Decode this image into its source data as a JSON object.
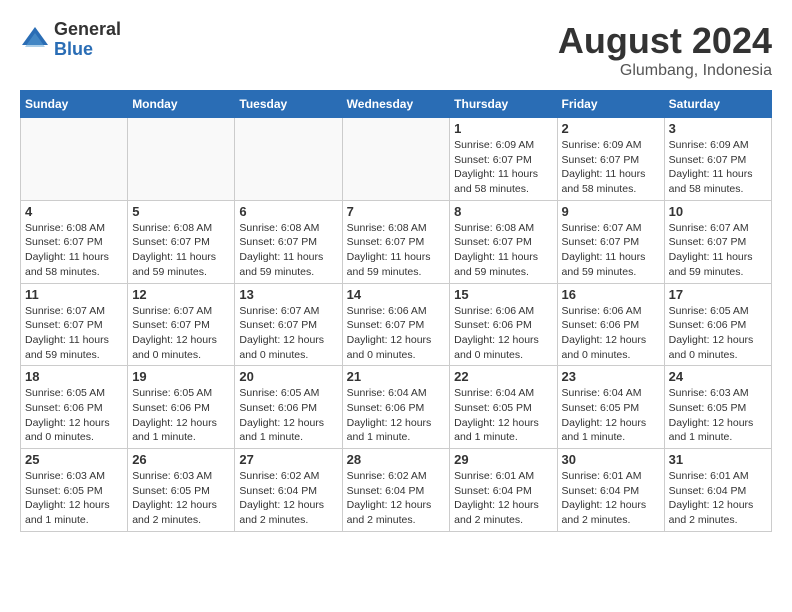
{
  "header": {
    "logo_general": "General",
    "logo_blue": "Blue",
    "month_year": "August 2024",
    "location": "Glumbang, Indonesia"
  },
  "days_of_week": [
    "Sunday",
    "Monday",
    "Tuesday",
    "Wednesday",
    "Thursday",
    "Friday",
    "Saturday"
  ],
  "weeks": [
    [
      {
        "day": "",
        "info": ""
      },
      {
        "day": "",
        "info": ""
      },
      {
        "day": "",
        "info": ""
      },
      {
        "day": "",
        "info": ""
      },
      {
        "day": "1",
        "info": "Sunrise: 6:09 AM\nSunset: 6:07 PM\nDaylight: 11 hours\nand 58 minutes."
      },
      {
        "day": "2",
        "info": "Sunrise: 6:09 AM\nSunset: 6:07 PM\nDaylight: 11 hours\nand 58 minutes."
      },
      {
        "day": "3",
        "info": "Sunrise: 6:09 AM\nSunset: 6:07 PM\nDaylight: 11 hours\nand 58 minutes."
      }
    ],
    [
      {
        "day": "4",
        "info": "Sunrise: 6:08 AM\nSunset: 6:07 PM\nDaylight: 11 hours\nand 58 minutes."
      },
      {
        "day": "5",
        "info": "Sunrise: 6:08 AM\nSunset: 6:07 PM\nDaylight: 11 hours\nand 59 minutes."
      },
      {
        "day": "6",
        "info": "Sunrise: 6:08 AM\nSunset: 6:07 PM\nDaylight: 11 hours\nand 59 minutes."
      },
      {
        "day": "7",
        "info": "Sunrise: 6:08 AM\nSunset: 6:07 PM\nDaylight: 11 hours\nand 59 minutes."
      },
      {
        "day": "8",
        "info": "Sunrise: 6:08 AM\nSunset: 6:07 PM\nDaylight: 11 hours\nand 59 minutes."
      },
      {
        "day": "9",
        "info": "Sunrise: 6:07 AM\nSunset: 6:07 PM\nDaylight: 11 hours\nand 59 minutes."
      },
      {
        "day": "10",
        "info": "Sunrise: 6:07 AM\nSunset: 6:07 PM\nDaylight: 11 hours\nand 59 minutes."
      }
    ],
    [
      {
        "day": "11",
        "info": "Sunrise: 6:07 AM\nSunset: 6:07 PM\nDaylight: 11 hours\nand 59 minutes."
      },
      {
        "day": "12",
        "info": "Sunrise: 6:07 AM\nSunset: 6:07 PM\nDaylight: 12 hours\nand 0 minutes."
      },
      {
        "day": "13",
        "info": "Sunrise: 6:07 AM\nSunset: 6:07 PM\nDaylight: 12 hours\nand 0 minutes."
      },
      {
        "day": "14",
        "info": "Sunrise: 6:06 AM\nSunset: 6:07 PM\nDaylight: 12 hours\nand 0 minutes."
      },
      {
        "day": "15",
        "info": "Sunrise: 6:06 AM\nSunset: 6:06 PM\nDaylight: 12 hours\nand 0 minutes."
      },
      {
        "day": "16",
        "info": "Sunrise: 6:06 AM\nSunset: 6:06 PM\nDaylight: 12 hours\nand 0 minutes."
      },
      {
        "day": "17",
        "info": "Sunrise: 6:05 AM\nSunset: 6:06 PM\nDaylight: 12 hours\nand 0 minutes."
      }
    ],
    [
      {
        "day": "18",
        "info": "Sunrise: 6:05 AM\nSunset: 6:06 PM\nDaylight: 12 hours\nand 0 minutes."
      },
      {
        "day": "19",
        "info": "Sunrise: 6:05 AM\nSunset: 6:06 PM\nDaylight: 12 hours\nand 1 minute."
      },
      {
        "day": "20",
        "info": "Sunrise: 6:05 AM\nSunset: 6:06 PM\nDaylight: 12 hours\nand 1 minute."
      },
      {
        "day": "21",
        "info": "Sunrise: 6:04 AM\nSunset: 6:06 PM\nDaylight: 12 hours\nand 1 minute."
      },
      {
        "day": "22",
        "info": "Sunrise: 6:04 AM\nSunset: 6:05 PM\nDaylight: 12 hours\nand 1 minute."
      },
      {
        "day": "23",
        "info": "Sunrise: 6:04 AM\nSunset: 6:05 PM\nDaylight: 12 hours\nand 1 minute."
      },
      {
        "day": "24",
        "info": "Sunrise: 6:03 AM\nSunset: 6:05 PM\nDaylight: 12 hours\nand 1 minute."
      }
    ],
    [
      {
        "day": "25",
        "info": "Sunrise: 6:03 AM\nSunset: 6:05 PM\nDaylight: 12 hours\nand 1 minute."
      },
      {
        "day": "26",
        "info": "Sunrise: 6:03 AM\nSunset: 6:05 PM\nDaylight: 12 hours\nand 2 minutes."
      },
      {
        "day": "27",
        "info": "Sunrise: 6:02 AM\nSunset: 6:04 PM\nDaylight: 12 hours\nand 2 minutes."
      },
      {
        "day": "28",
        "info": "Sunrise: 6:02 AM\nSunset: 6:04 PM\nDaylight: 12 hours\nand 2 minutes."
      },
      {
        "day": "29",
        "info": "Sunrise: 6:01 AM\nSunset: 6:04 PM\nDaylight: 12 hours\nand 2 minutes."
      },
      {
        "day": "30",
        "info": "Sunrise: 6:01 AM\nSunset: 6:04 PM\nDaylight: 12 hours\nand 2 minutes."
      },
      {
        "day": "31",
        "info": "Sunrise: 6:01 AM\nSunset: 6:04 PM\nDaylight: 12 hours\nand 2 minutes."
      }
    ]
  ]
}
